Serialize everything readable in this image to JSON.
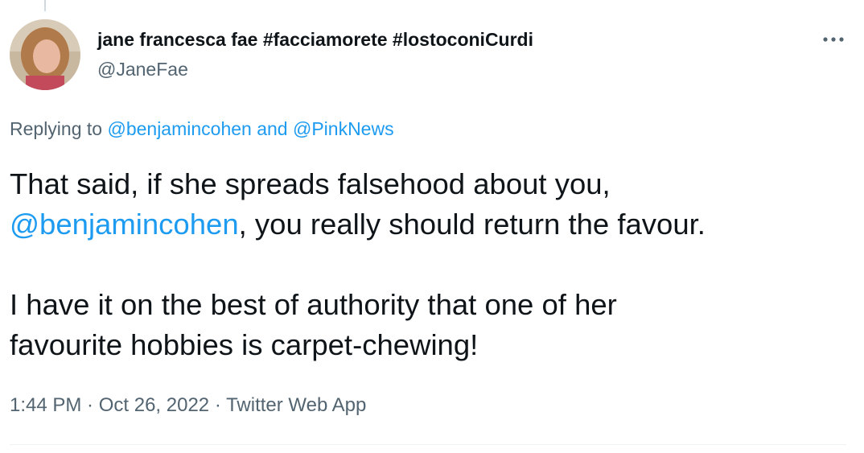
{
  "author": {
    "display_name": "jane francesca fae #facciamorete #lostoconiCurdi",
    "handle": "@JaneFae"
  },
  "reply": {
    "prefix": "Replying to ",
    "user1": "@benjamincohen",
    "joiner": " and ",
    "user2": "@PinkNews"
  },
  "tweet": {
    "line1": "That said, if she spreads falsehood about you,",
    "mention": "@benjamincohen",
    "line2_rest": ", you really should return the favour.",
    "line3": "I have it on the best of authority that one of her",
    "line4": "favourite hobbies is carpet-chewing!"
  },
  "meta": {
    "time": "1:44 PM",
    "sep1": " · ",
    "date": "Oct 26, 2022",
    "sep2": " · ",
    "app": "Twitter Web App"
  },
  "icons": {
    "more": "more-horizontal-icon"
  },
  "colors": {
    "link": "#1d9bf0",
    "secondary_text": "#536471",
    "primary_text": "#0f1419"
  }
}
